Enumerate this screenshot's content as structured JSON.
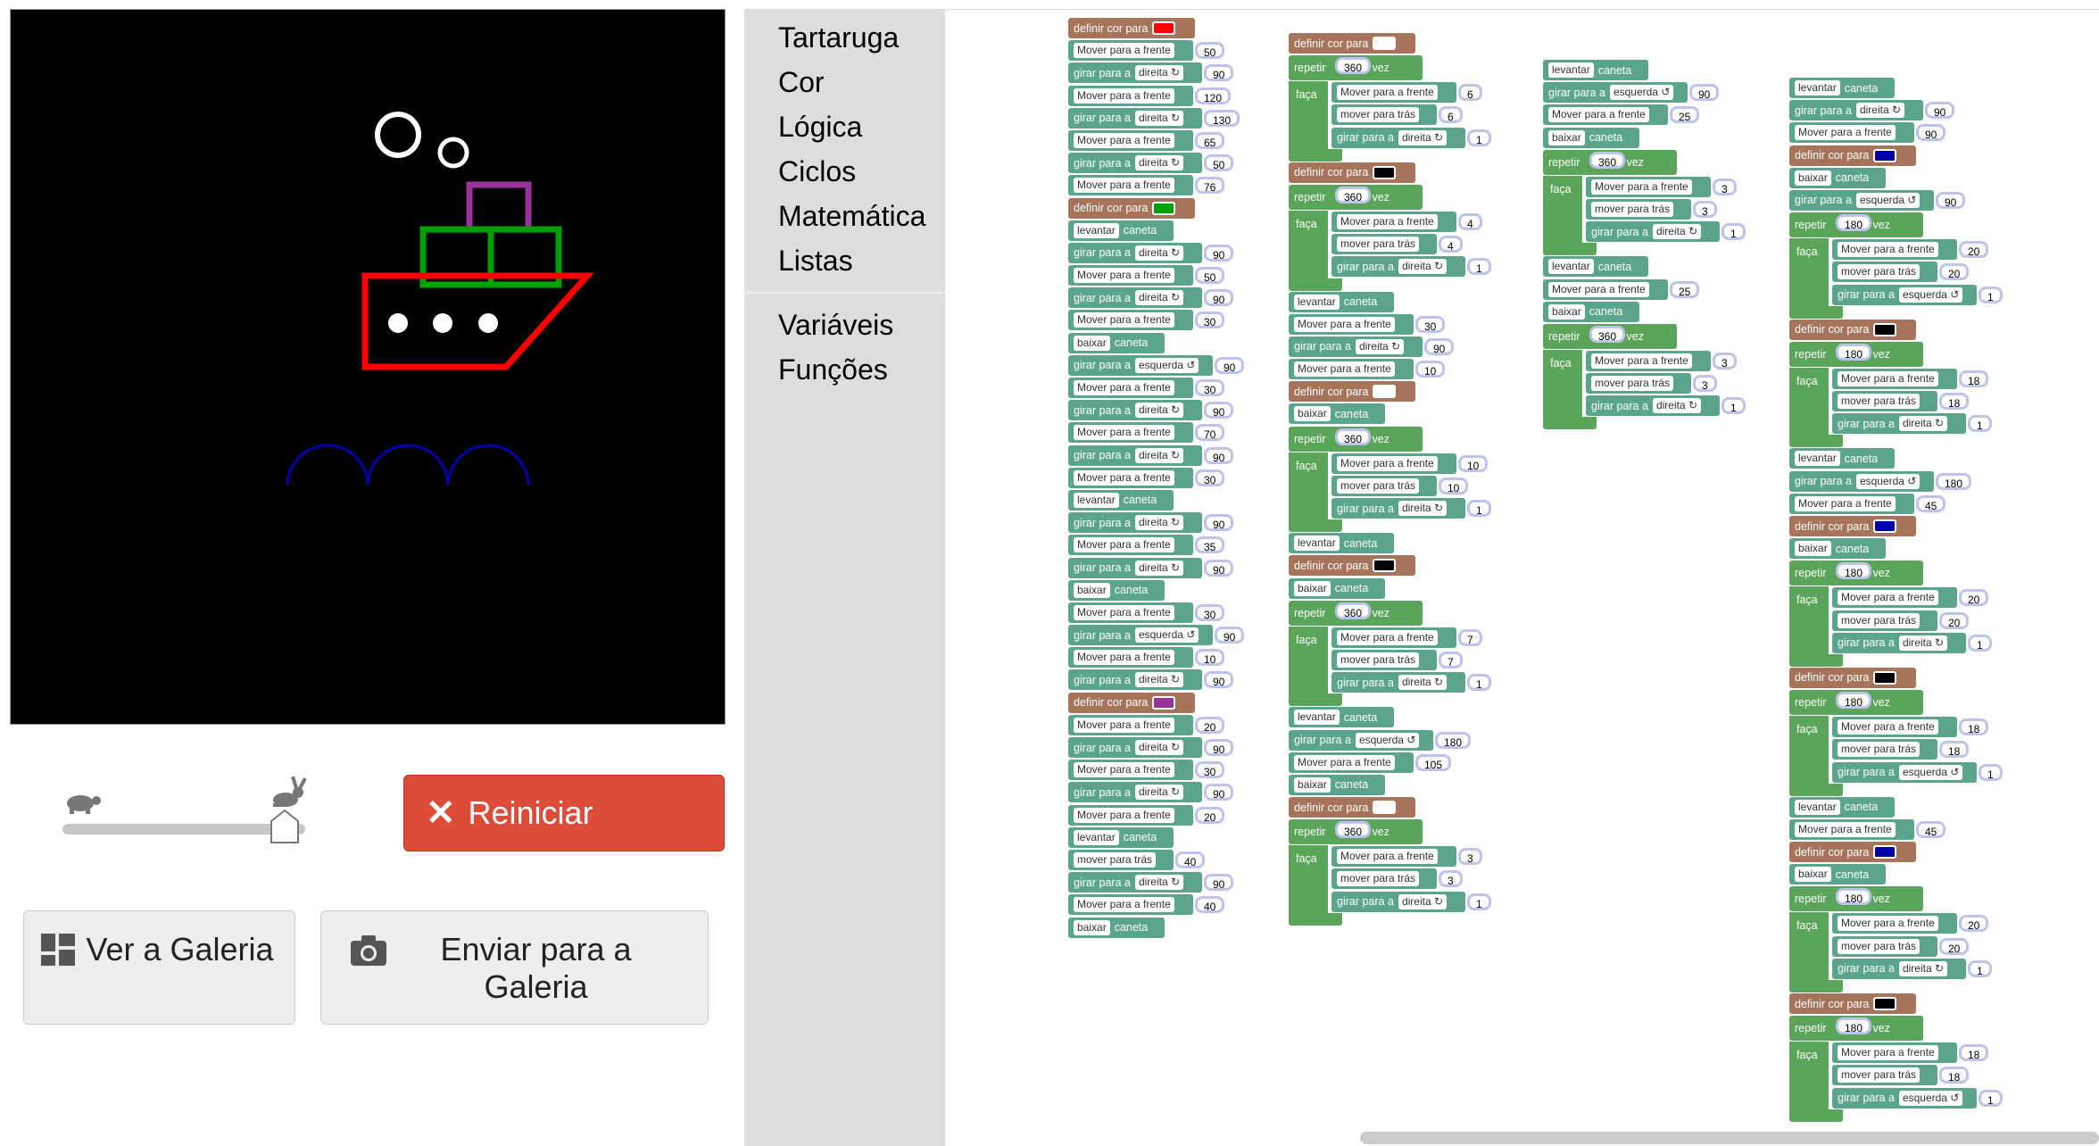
{
  "toolbox": {
    "categories": [
      "Tartaruga",
      "Cor",
      "Lógica",
      "Ciclos",
      "Matemática",
      "Listas",
      "Variáveis",
      "Funções"
    ]
  },
  "controls": {
    "reset_label": "Reiniciar",
    "gallery_label": "Ver a Galeria",
    "share_label": "Enviar para a Galeria",
    "speed_level": 1.0
  },
  "colors": {
    "ship_hull": "#ff0000",
    "ship_cabin": "#00a000",
    "ship_top": "#993399",
    "waves": "#0000aa",
    "bubbles": "#ffffff",
    "canvas_bg": "#000000",
    "reset": "#dd4b39"
  },
  "blocks": {
    "labels": {
      "set_color": "definir cor para",
      "forward": "Mover para a frente",
      "backward": "mover para trás",
      "turn": "girar para a",
      "right": "direita ↻",
      "left": "esquerda ↺",
      "pen_up": "levantar",
      "pen_down": "baixar",
      "pen": "caneta",
      "repeat": "repetir",
      "times": "vez",
      "do": "faça"
    },
    "stacks": [
      {
        "id": "s1",
        "items": [
          [
            "col",
            "#ff0000"
          ],
          [
            "fwd",
            "50"
          ],
          [
            "turnR",
            "90"
          ],
          [
            "fwd",
            "120"
          ],
          [
            "turnR",
            "130"
          ],
          [
            "fwd",
            "65"
          ],
          [
            "turnR",
            "50"
          ],
          [
            "fwd",
            "76"
          ],
          [
            "col",
            "#00a000"
          ],
          [
            "up"
          ],
          [
            "turnR",
            "90"
          ],
          [
            "fwd",
            "50"
          ],
          [
            "turnR",
            "90"
          ],
          [
            "fwd",
            "30"
          ],
          [
            "down"
          ],
          [
            "turnL",
            "90"
          ],
          [
            "fwd",
            "30"
          ],
          [
            "turnR",
            "90"
          ],
          [
            "fwd",
            "70"
          ],
          [
            "turnR",
            "90"
          ],
          [
            "fwd",
            "30"
          ],
          [
            "up"
          ],
          [
            "turnR",
            "90"
          ],
          [
            "fwd",
            "35"
          ],
          [
            "turnR",
            "90"
          ],
          [
            "down"
          ],
          [
            "fwd",
            "30"
          ],
          [
            "turnL",
            "90"
          ],
          [
            "fwd",
            "10"
          ],
          [
            "turnR",
            "90"
          ],
          [
            "col",
            "#993399"
          ],
          [
            "fwd",
            "20"
          ],
          [
            "turnR",
            "90"
          ],
          [
            "fwd",
            "30"
          ],
          [
            "turnR",
            "90"
          ],
          [
            "fwd",
            "20"
          ],
          [
            "up"
          ],
          [
            "back",
            "40"
          ],
          [
            "turnR",
            "90"
          ],
          [
            "fwd",
            "40"
          ],
          [
            "down"
          ]
        ]
      },
      {
        "id": "s2",
        "items": [
          [
            "col",
            "#ffffff"
          ],
          [
            "rep",
            "360",
            [
              [
                "fwd",
                "6"
              ],
              [
                "back",
                "6"
              ],
              [
                "turnR",
                "1"
              ]
            ]
          ],
          [
            "col",
            "#000000"
          ],
          [
            "rep",
            "360",
            [
              [
                "fwd",
                "4"
              ],
              [
                "back",
                "4"
              ],
              [
                "turnR",
                "1"
              ]
            ]
          ],
          [
            "up"
          ],
          [
            "fwd",
            "30"
          ],
          [
            "turnR",
            "90"
          ],
          [
            "fwd",
            "10"
          ],
          [
            "col",
            "#ffffff"
          ],
          [
            "down"
          ],
          [
            "rep",
            "360",
            [
              [
                "fwd",
                "10"
              ],
              [
                "back",
                "10"
              ],
              [
                "turnR",
                "1"
              ]
            ]
          ],
          [
            "up"
          ],
          [
            "col",
            "#000000"
          ],
          [
            "down"
          ],
          [
            "rep",
            "360",
            [
              [
                "fwd",
                "7"
              ],
              [
                "back",
                "7"
              ],
              [
                "turnR",
                "1"
              ]
            ]
          ],
          [
            "up"
          ],
          [
            "turnL",
            "180"
          ],
          [
            "fwd",
            "105"
          ],
          [
            "down"
          ],
          [
            "col",
            "#ffffff"
          ],
          [
            "rep",
            "360",
            [
              [
                "fwd",
                "3"
              ],
              [
                "back",
                "3"
              ],
              [
                "turnR",
                "1"
              ]
            ]
          ]
        ]
      },
      {
        "id": "s3",
        "items": [
          [
            "up"
          ],
          [
            "turnL",
            "90"
          ],
          [
            "fwd",
            "25"
          ],
          [
            "down"
          ],
          [
            "rep",
            "360",
            [
              [
                "fwd",
                "3"
              ],
              [
                "back",
                "3"
              ],
              [
                "turnR",
                "1"
              ]
            ]
          ],
          [
            "up"
          ],
          [
            "fwd",
            "25"
          ],
          [
            "down"
          ],
          [
            "rep",
            "360",
            [
              [
                "fwd",
                "3"
              ],
              [
                "back",
                "3"
              ],
              [
                "turnR",
                "1"
              ]
            ]
          ]
        ]
      },
      {
        "id": "s4",
        "items": [
          [
            "up"
          ],
          [
            "turnR",
            "90"
          ],
          [
            "fwd",
            "90"
          ],
          [
            "col",
            "#0000aa"
          ],
          [
            "down"
          ],
          [
            "turnL",
            "90"
          ],
          [
            "rep",
            "180",
            [
              [
                "fwd",
                "20"
              ],
              [
                "back",
                "20"
              ],
              [
                "turnL",
                "1"
              ]
            ]
          ],
          [
            "col",
            "#000000"
          ],
          [
            "rep",
            "180",
            [
              [
                "fwd",
                "18"
              ],
              [
                "back",
                "18"
              ],
              [
                "turnR",
                "1"
              ]
            ]
          ],
          [
            "up"
          ],
          [
            "turnL",
            "180"
          ],
          [
            "fwd",
            "45"
          ],
          [
            "col",
            "#0000aa"
          ],
          [
            "down"
          ],
          [
            "rep",
            "180",
            [
              [
                "fwd",
                "20"
              ],
              [
                "back",
                "20"
              ],
              [
                "turnR",
                "1"
              ]
            ]
          ],
          [
            "col",
            "#000000"
          ],
          [
            "rep",
            "180",
            [
              [
                "fwd",
                "18"
              ],
              [
                "back",
                "18"
              ],
              [
                "turnL",
                "1"
              ]
            ]
          ],
          [
            "up"
          ],
          [
            "fwd",
            "45"
          ],
          [
            "col",
            "#0000aa"
          ],
          [
            "down"
          ],
          [
            "rep",
            "180",
            [
              [
                "fwd",
                "20"
              ],
              [
                "back",
                "20"
              ],
              [
                "turnR",
                "1"
              ]
            ]
          ],
          [
            "col",
            "#000000"
          ],
          [
            "rep",
            "180",
            [
              [
                "fwd",
                "18"
              ],
              [
                "back",
                "18"
              ],
              [
                "turnL",
                "1"
              ]
            ]
          ]
        ]
      }
    ]
  }
}
